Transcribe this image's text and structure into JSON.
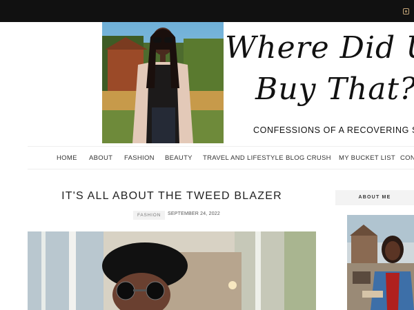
{
  "topbar": {
    "icon": "instagram-icon"
  },
  "header": {
    "title_line1": "Where Did U",
    "title_line2": "Buy That?",
    "tagline": "CONFESSIONS OF A RECOVERING SH"
  },
  "nav": {
    "items": [
      {
        "label": "HOME"
      },
      {
        "label": "ABOUT"
      },
      {
        "label": "FASHION"
      },
      {
        "label": "BEAUTY"
      },
      {
        "label": "TRAVEL AND LIFESTYLE"
      },
      {
        "label": "BLOG CRUSH"
      },
      {
        "label": "MY BUCKET LIST"
      },
      {
        "label": "CONT"
      }
    ]
  },
  "post": {
    "title": "IT'S ALL ABOUT THE TWEED BLAZER",
    "category": "FASHION",
    "date": "SEPTEMBER 24, 2022"
  },
  "sidebar": {
    "widget_title": "ABOUT ME"
  },
  "colors": {
    "topbar": "#111111",
    "accent_icon": "#c8a97a",
    "nav_border": "#eeeeee"
  }
}
